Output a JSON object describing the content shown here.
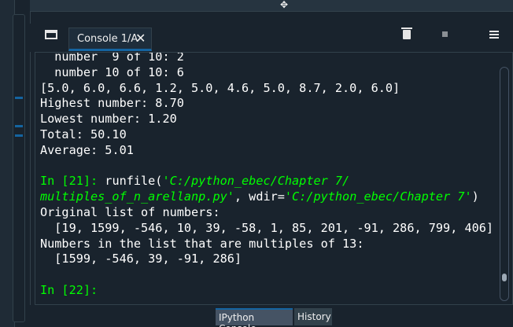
{
  "pane": {
    "tab_label": "Console 1/A",
    "tab_close": "✕"
  },
  "console_lines": [
    {
      "kind": "out",
      "text": "  number  9 of 10: 2"
    },
    {
      "kind": "out",
      "text": "  number 10 of 10: 6"
    },
    {
      "kind": "out",
      "text": "[5.0, 6.0, 6.6, 1.2, 5.0, 4.6, 5.0, 8.7, 2.0, 6.0]"
    },
    {
      "kind": "out",
      "text": "Highest number: 8.70"
    },
    {
      "kind": "out",
      "text": "Lowest number: 1.20"
    },
    {
      "kind": "out",
      "text": "Total: 50.10"
    },
    {
      "kind": "out",
      "text": "Average: 5.01"
    },
    {
      "kind": "out",
      "text": ""
    },
    {
      "kind": "cmd1",
      "prompt": "In [21]:",
      "pre": " runfile(",
      "arg": "'C:/python_ebec/Chapter 7/"
    },
    {
      "kind": "cmd2",
      "arg": "multiples_of_n_arellanp.py'",
      "mid": ", wdir=",
      "arg2": "'C:/python_ebec/Chapter 7'",
      "post": ")"
    },
    {
      "kind": "out",
      "text": "Original list of numbers:"
    },
    {
      "kind": "out",
      "text": "  [19, 1599, -546, 10, 39, -58, 1, 85, 201, -91, 286, 799, 406]"
    },
    {
      "kind": "out",
      "text": "Numbers in the list that are multiples of 13:"
    },
    {
      "kind": "out",
      "text": "  [1599, -546, 39, -91, 286]"
    },
    {
      "kind": "out",
      "text": ""
    },
    {
      "kind": "prompt",
      "prompt": "In [22]:"
    }
  ],
  "bottom_tabs": {
    "active": "IPython Console",
    "inactive": "History"
  },
  "icons": {
    "browse": "browse-tabs-icon",
    "trash": "trash-icon",
    "stop": "stop-icon",
    "menu": "hamburger-menu-icon",
    "drag": "move-icon",
    "undock": "undock-icon"
  },
  "colors": {
    "background": "#19232d",
    "prompt_green": "#00ff00",
    "accent_blue": "#1464a0"
  }
}
